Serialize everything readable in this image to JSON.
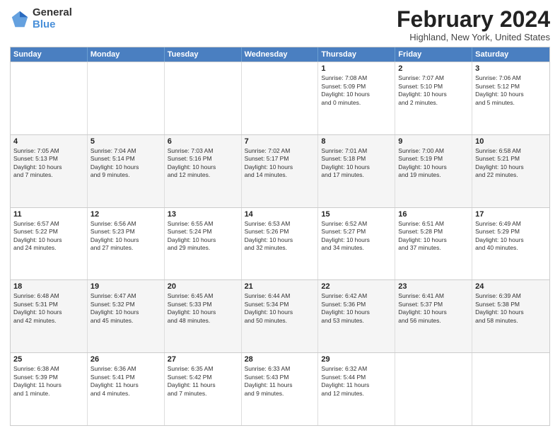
{
  "logo": {
    "general": "General",
    "blue": "Blue"
  },
  "title": "February 2024",
  "subtitle": "Highland, New York, United States",
  "days": [
    "Sunday",
    "Monday",
    "Tuesday",
    "Wednesday",
    "Thursday",
    "Friday",
    "Saturday"
  ],
  "rows": [
    [
      {
        "day": "",
        "text": ""
      },
      {
        "day": "",
        "text": ""
      },
      {
        "day": "",
        "text": ""
      },
      {
        "day": "",
        "text": ""
      },
      {
        "day": "1",
        "text": "Sunrise: 7:08 AM\nSunset: 5:09 PM\nDaylight: 10 hours\nand 0 minutes."
      },
      {
        "day": "2",
        "text": "Sunrise: 7:07 AM\nSunset: 5:10 PM\nDaylight: 10 hours\nand 2 minutes."
      },
      {
        "day": "3",
        "text": "Sunrise: 7:06 AM\nSunset: 5:12 PM\nDaylight: 10 hours\nand 5 minutes."
      }
    ],
    [
      {
        "day": "4",
        "text": "Sunrise: 7:05 AM\nSunset: 5:13 PM\nDaylight: 10 hours\nand 7 minutes."
      },
      {
        "day": "5",
        "text": "Sunrise: 7:04 AM\nSunset: 5:14 PM\nDaylight: 10 hours\nand 9 minutes."
      },
      {
        "day": "6",
        "text": "Sunrise: 7:03 AM\nSunset: 5:16 PM\nDaylight: 10 hours\nand 12 minutes."
      },
      {
        "day": "7",
        "text": "Sunrise: 7:02 AM\nSunset: 5:17 PM\nDaylight: 10 hours\nand 14 minutes."
      },
      {
        "day": "8",
        "text": "Sunrise: 7:01 AM\nSunset: 5:18 PM\nDaylight: 10 hours\nand 17 minutes."
      },
      {
        "day": "9",
        "text": "Sunrise: 7:00 AM\nSunset: 5:19 PM\nDaylight: 10 hours\nand 19 minutes."
      },
      {
        "day": "10",
        "text": "Sunrise: 6:58 AM\nSunset: 5:21 PM\nDaylight: 10 hours\nand 22 minutes."
      }
    ],
    [
      {
        "day": "11",
        "text": "Sunrise: 6:57 AM\nSunset: 5:22 PM\nDaylight: 10 hours\nand 24 minutes."
      },
      {
        "day": "12",
        "text": "Sunrise: 6:56 AM\nSunset: 5:23 PM\nDaylight: 10 hours\nand 27 minutes."
      },
      {
        "day": "13",
        "text": "Sunrise: 6:55 AM\nSunset: 5:24 PM\nDaylight: 10 hours\nand 29 minutes."
      },
      {
        "day": "14",
        "text": "Sunrise: 6:53 AM\nSunset: 5:26 PM\nDaylight: 10 hours\nand 32 minutes."
      },
      {
        "day": "15",
        "text": "Sunrise: 6:52 AM\nSunset: 5:27 PM\nDaylight: 10 hours\nand 34 minutes."
      },
      {
        "day": "16",
        "text": "Sunrise: 6:51 AM\nSunset: 5:28 PM\nDaylight: 10 hours\nand 37 minutes."
      },
      {
        "day": "17",
        "text": "Sunrise: 6:49 AM\nSunset: 5:29 PM\nDaylight: 10 hours\nand 40 minutes."
      }
    ],
    [
      {
        "day": "18",
        "text": "Sunrise: 6:48 AM\nSunset: 5:31 PM\nDaylight: 10 hours\nand 42 minutes."
      },
      {
        "day": "19",
        "text": "Sunrise: 6:47 AM\nSunset: 5:32 PM\nDaylight: 10 hours\nand 45 minutes."
      },
      {
        "day": "20",
        "text": "Sunrise: 6:45 AM\nSunset: 5:33 PM\nDaylight: 10 hours\nand 48 minutes."
      },
      {
        "day": "21",
        "text": "Sunrise: 6:44 AM\nSunset: 5:34 PM\nDaylight: 10 hours\nand 50 minutes."
      },
      {
        "day": "22",
        "text": "Sunrise: 6:42 AM\nSunset: 5:36 PM\nDaylight: 10 hours\nand 53 minutes."
      },
      {
        "day": "23",
        "text": "Sunrise: 6:41 AM\nSunset: 5:37 PM\nDaylight: 10 hours\nand 56 minutes."
      },
      {
        "day": "24",
        "text": "Sunrise: 6:39 AM\nSunset: 5:38 PM\nDaylight: 10 hours\nand 58 minutes."
      }
    ],
    [
      {
        "day": "25",
        "text": "Sunrise: 6:38 AM\nSunset: 5:39 PM\nDaylight: 11 hours\nand 1 minute."
      },
      {
        "day": "26",
        "text": "Sunrise: 6:36 AM\nSunset: 5:41 PM\nDaylight: 11 hours\nand 4 minutes."
      },
      {
        "day": "27",
        "text": "Sunrise: 6:35 AM\nSunset: 5:42 PM\nDaylight: 11 hours\nand 7 minutes."
      },
      {
        "day": "28",
        "text": "Sunrise: 6:33 AM\nSunset: 5:43 PM\nDaylight: 11 hours\nand 9 minutes."
      },
      {
        "day": "29",
        "text": "Sunrise: 6:32 AM\nSunset: 5:44 PM\nDaylight: 11 hours\nand 12 minutes."
      },
      {
        "day": "",
        "text": ""
      },
      {
        "day": "",
        "text": ""
      }
    ]
  ]
}
